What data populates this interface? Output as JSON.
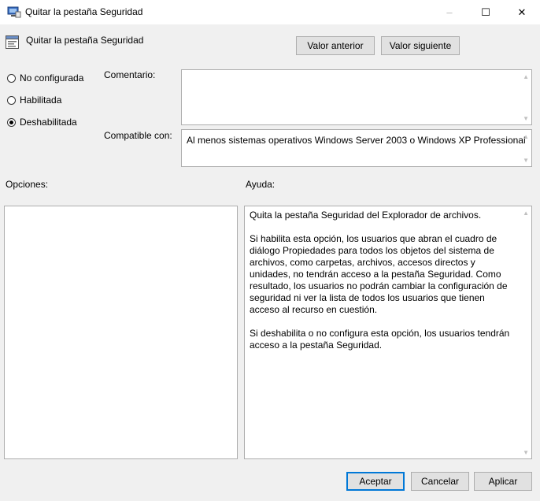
{
  "window": {
    "title": "Quitar la pestaña Seguridad",
    "controls": {
      "minimize": "–",
      "maximize": "☐",
      "close": "✕"
    }
  },
  "header": {
    "policy_name": "Quitar la pestaña Seguridad",
    "prev_button": "Valor anterior",
    "next_button": "Valor siguiente"
  },
  "state": {
    "options": [
      {
        "label": "No configurada",
        "selected": false
      },
      {
        "label": "Habilitada",
        "selected": false
      },
      {
        "label": "Deshabilitada",
        "selected": true
      }
    ]
  },
  "comment": {
    "label": "Comentario:",
    "value": ""
  },
  "supported": {
    "label": "Compatible con:",
    "value": "Al menos sistemas operativos Windows Server 2003 o Windows XP Professional"
  },
  "options_panel": {
    "label": "Opciones:"
  },
  "help_panel": {
    "label": "Ayuda:",
    "text": "Quita la pestaña Seguridad del Explorador de archivos.\n\nSi habilita esta opción, los usuarios que abran el cuadro de diálogo Propiedades para todos los objetos del sistema de archivos, como carpetas, archivos, accesos directos y unidades, no tendrán acceso a la pestaña Seguridad. Como resultado, los usuarios no podrán cambiar la configuración de seguridad ni ver la lista de todos los usuarios que tienen acceso al recurso en cuestión.\n\nSi deshabilita o no configura esta opción, los usuarios tendrán acceso a la pestaña Seguridad."
  },
  "footer": {
    "ok": "Aceptar",
    "cancel": "Cancelar",
    "apply": "Aplicar"
  },
  "colors": {
    "accent": "#0078d7",
    "background": "#f0f0f0"
  }
}
